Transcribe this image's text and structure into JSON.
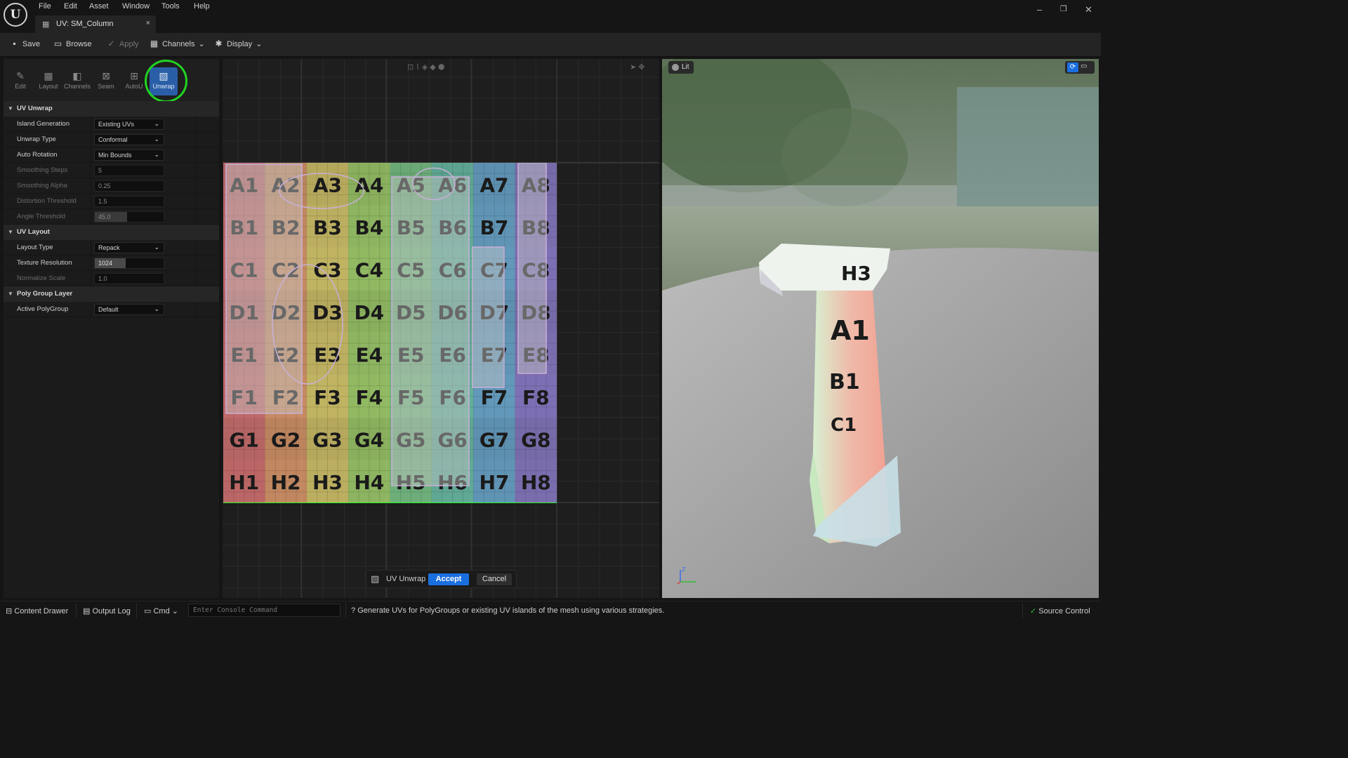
{
  "menu": {
    "logo": "U",
    "items": [
      "File",
      "Edit",
      "Asset",
      "Window",
      "Tools",
      "Help"
    ]
  },
  "document_tab": {
    "title": "UV: SM_Column",
    "close": "×"
  },
  "window_controls": {
    "minimize": "–",
    "restore": "❐",
    "close": "✕"
  },
  "toolbar": {
    "save": "Save",
    "browse": "Browse",
    "apply": "Apply",
    "channels": "Channels",
    "display": "Display"
  },
  "modes": [
    {
      "label": "Edit",
      "icon": "pencil-icon"
    },
    {
      "label": "Layout",
      "icon": "grid-icon"
    },
    {
      "label": "Channels",
      "icon": "channels-icon"
    },
    {
      "label": "Seam",
      "icon": "seam-icon"
    },
    {
      "label": "AutoU",
      "icon": "auto-uv-icon"
    },
    {
      "label": "Unwrap",
      "icon": "unwrap-icon",
      "active": true
    }
  ],
  "sections": {
    "uv_unwrap": "UV Unwrap",
    "uv_layout": "UV Layout",
    "poly_group_layer": "Poly Group Layer"
  },
  "properties": {
    "island_generation": {
      "label": "Island Generation",
      "value": "Existing UVs"
    },
    "unwrap_type": {
      "label": "Unwrap Type",
      "value": "Conformal"
    },
    "auto_rotation": {
      "label": "Auto Rotation",
      "value": "Min Bounds"
    },
    "smoothing_steps": {
      "label": "Smoothing Steps",
      "value": "5"
    },
    "smoothing_alpha": {
      "label": "Smoothing Alpha",
      "value": "0.25"
    },
    "distortion_threshold": {
      "label": "Distortion Threshold",
      "value": "1.5"
    },
    "angle_threshold": {
      "label": "Angle Threshold",
      "value": "45.0"
    },
    "layout_type": {
      "label": "Layout Type",
      "value": "Repack"
    },
    "texture_resolution": {
      "label": "Texture Resolution",
      "value": "1024"
    },
    "normalize_scale": {
      "label": "Normalize Scale",
      "value": "1.0"
    },
    "active_polygroup": {
      "label": "Active PolyGroup",
      "value": "Default"
    }
  },
  "uv_grid": {
    "rows": [
      "A",
      "B",
      "C",
      "D",
      "E",
      "F",
      "G",
      "H"
    ],
    "cols": [
      "1",
      "2",
      "3",
      "4",
      "5",
      "6",
      "7",
      "8"
    ],
    "column_colors": [
      "#e07878",
      "#e8a070",
      "#e0d070",
      "#a8d870",
      "#80d090",
      "#70c8b0",
      "#70b0d8",
      "#9080d0"
    ]
  },
  "unwrap_bar": {
    "label": "UV Unwrap",
    "accept": "Accept",
    "cancel": "Cancel"
  },
  "preview": {
    "lit_label": "Lit"
  },
  "statusbar": {
    "content_drawer": "Content Drawer",
    "output_log": "Output Log",
    "cmd": "Cmd",
    "console_placeholder": "Enter Console Command",
    "hint": "Generate UVs for PolyGroups or existing UV islands of the mesh using various strategies.",
    "source_control": "Source Control"
  }
}
